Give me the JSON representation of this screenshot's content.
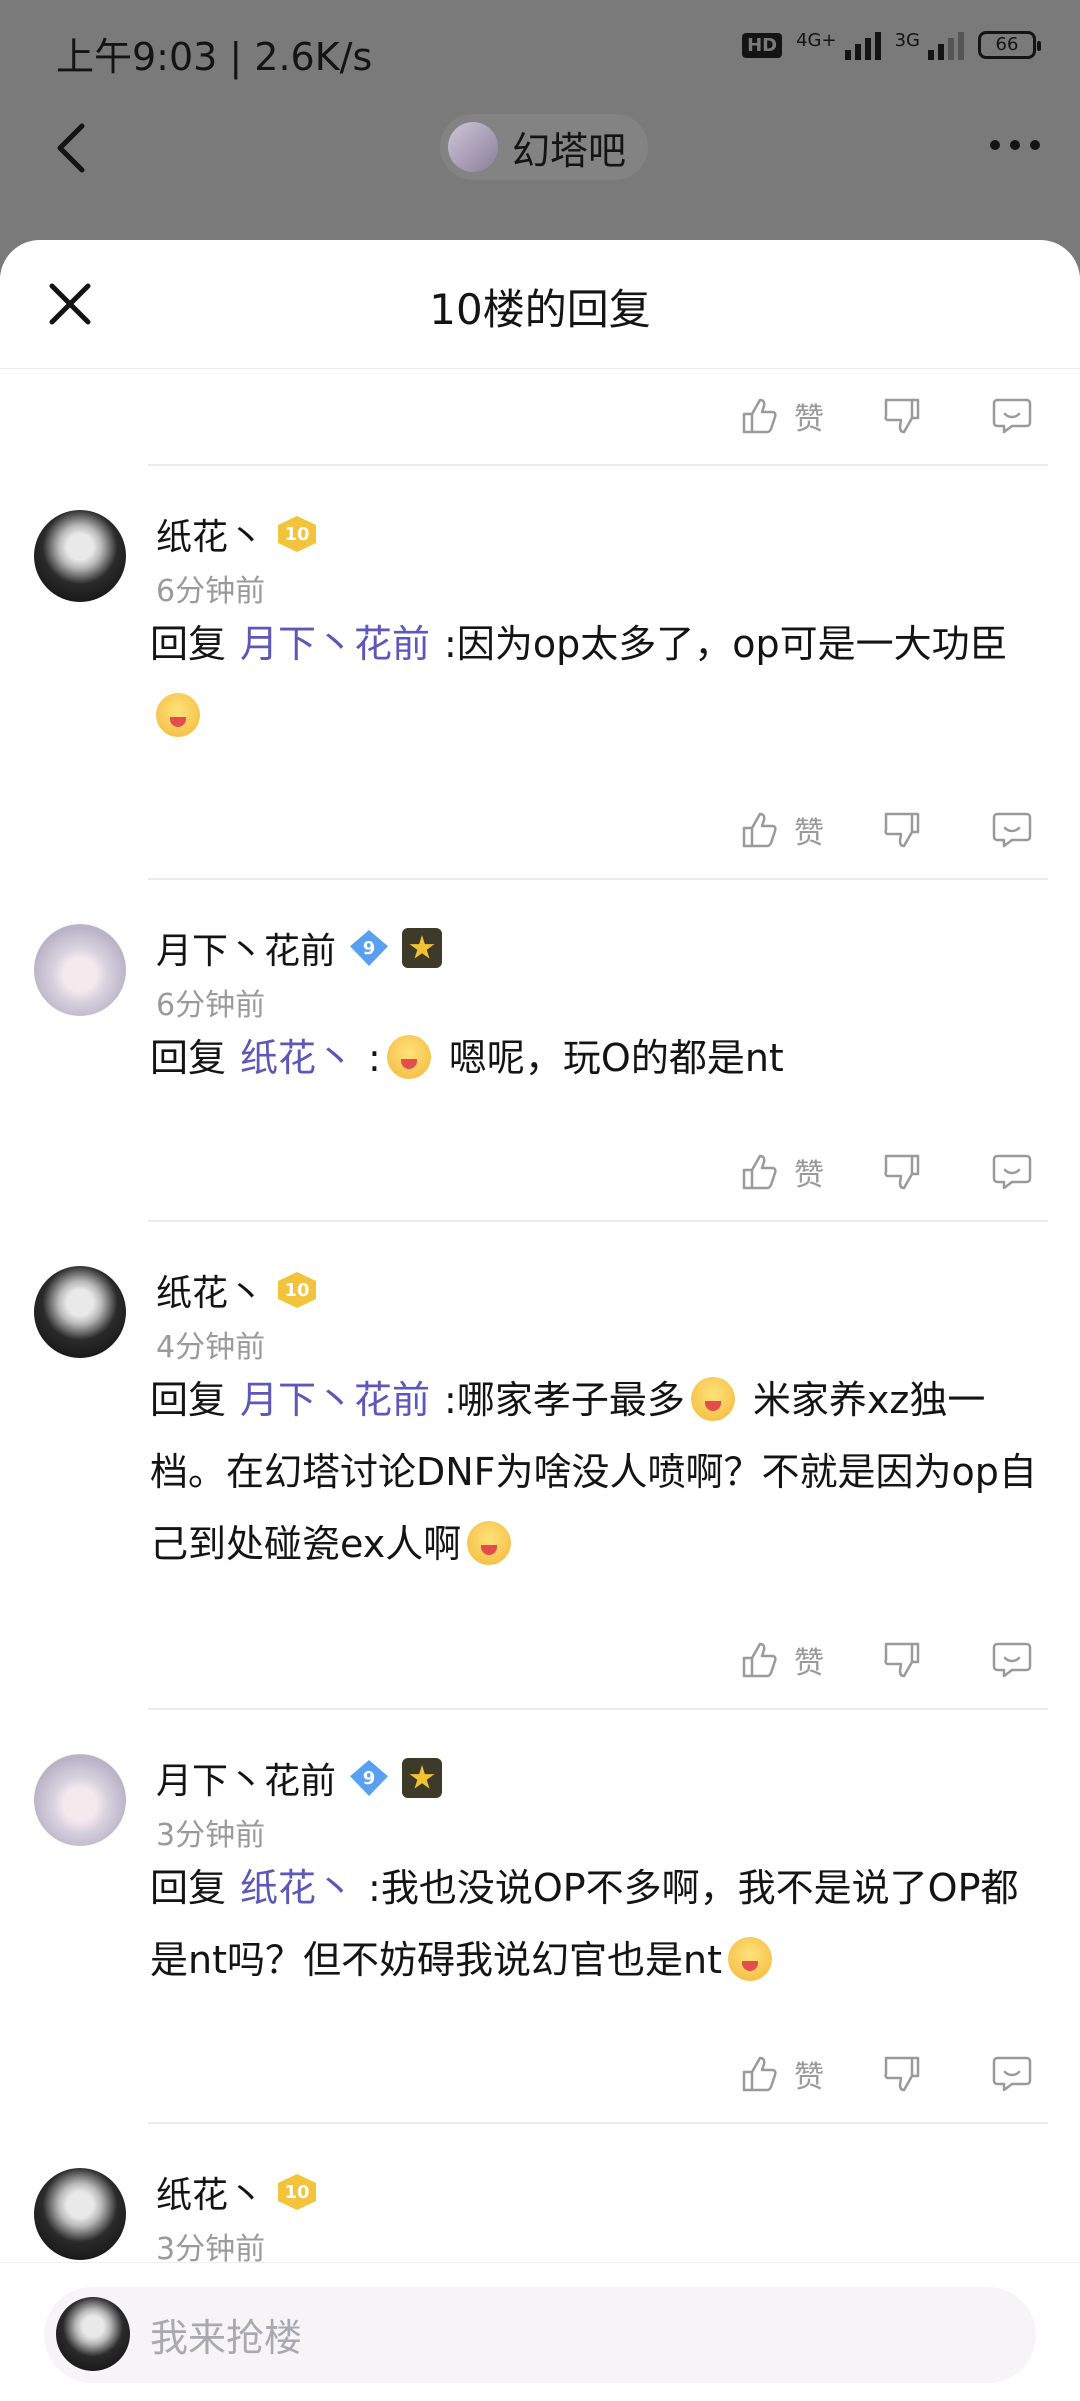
{
  "status": {
    "time": "上午9:03 | 2.6K/s",
    "hd": "HD",
    "net1": "4G+",
    "net2": "3G",
    "battery": "66"
  },
  "header": {
    "forum_name": "幻塔吧"
  },
  "sheet": {
    "title": "10楼的回复"
  },
  "actions": {
    "like": "赞"
  },
  "comments": [
    {
      "name": "纸花丶",
      "level": "10",
      "time": "6分钟前",
      "reply_prefix": "回复",
      "mention": "月下丶花前",
      "text": ":因为op太多了，op可是一大功臣"
    },
    {
      "name": "月下丶花前",
      "level": "9",
      "time": "6分钟前",
      "reply_prefix": "回复",
      "mention": "纸花丶",
      "text_before": ":",
      "text": " 嗯呢，玩O的都是nt"
    },
    {
      "name": "纸花丶",
      "level": "10",
      "time": "4分钟前",
      "reply_prefix": "回复",
      "mention": "月下丶花前",
      "text": ":哪家孝子最多",
      "text2": " 米家养xz独一档。在幻塔讨论DNF为啥没人喷啊？不就是因为op自己到处碰瓷ex人啊"
    },
    {
      "name": "月下丶花前",
      "level": "9",
      "time": "3分钟前",
      "reply_prefix": "回复",
      "mention": "纸花丶",
      "text": ":我也没说OP不多啊，我不是说了OP都是nt吗？但不妨碍我说幻官也是nt"
    },
    {
      "name": "纸花丶",
      "level": "10",
      "time": "3分钟前"
    }
  ],
  "input": {
    "placeholder": "我来抢楼"
  }
}
